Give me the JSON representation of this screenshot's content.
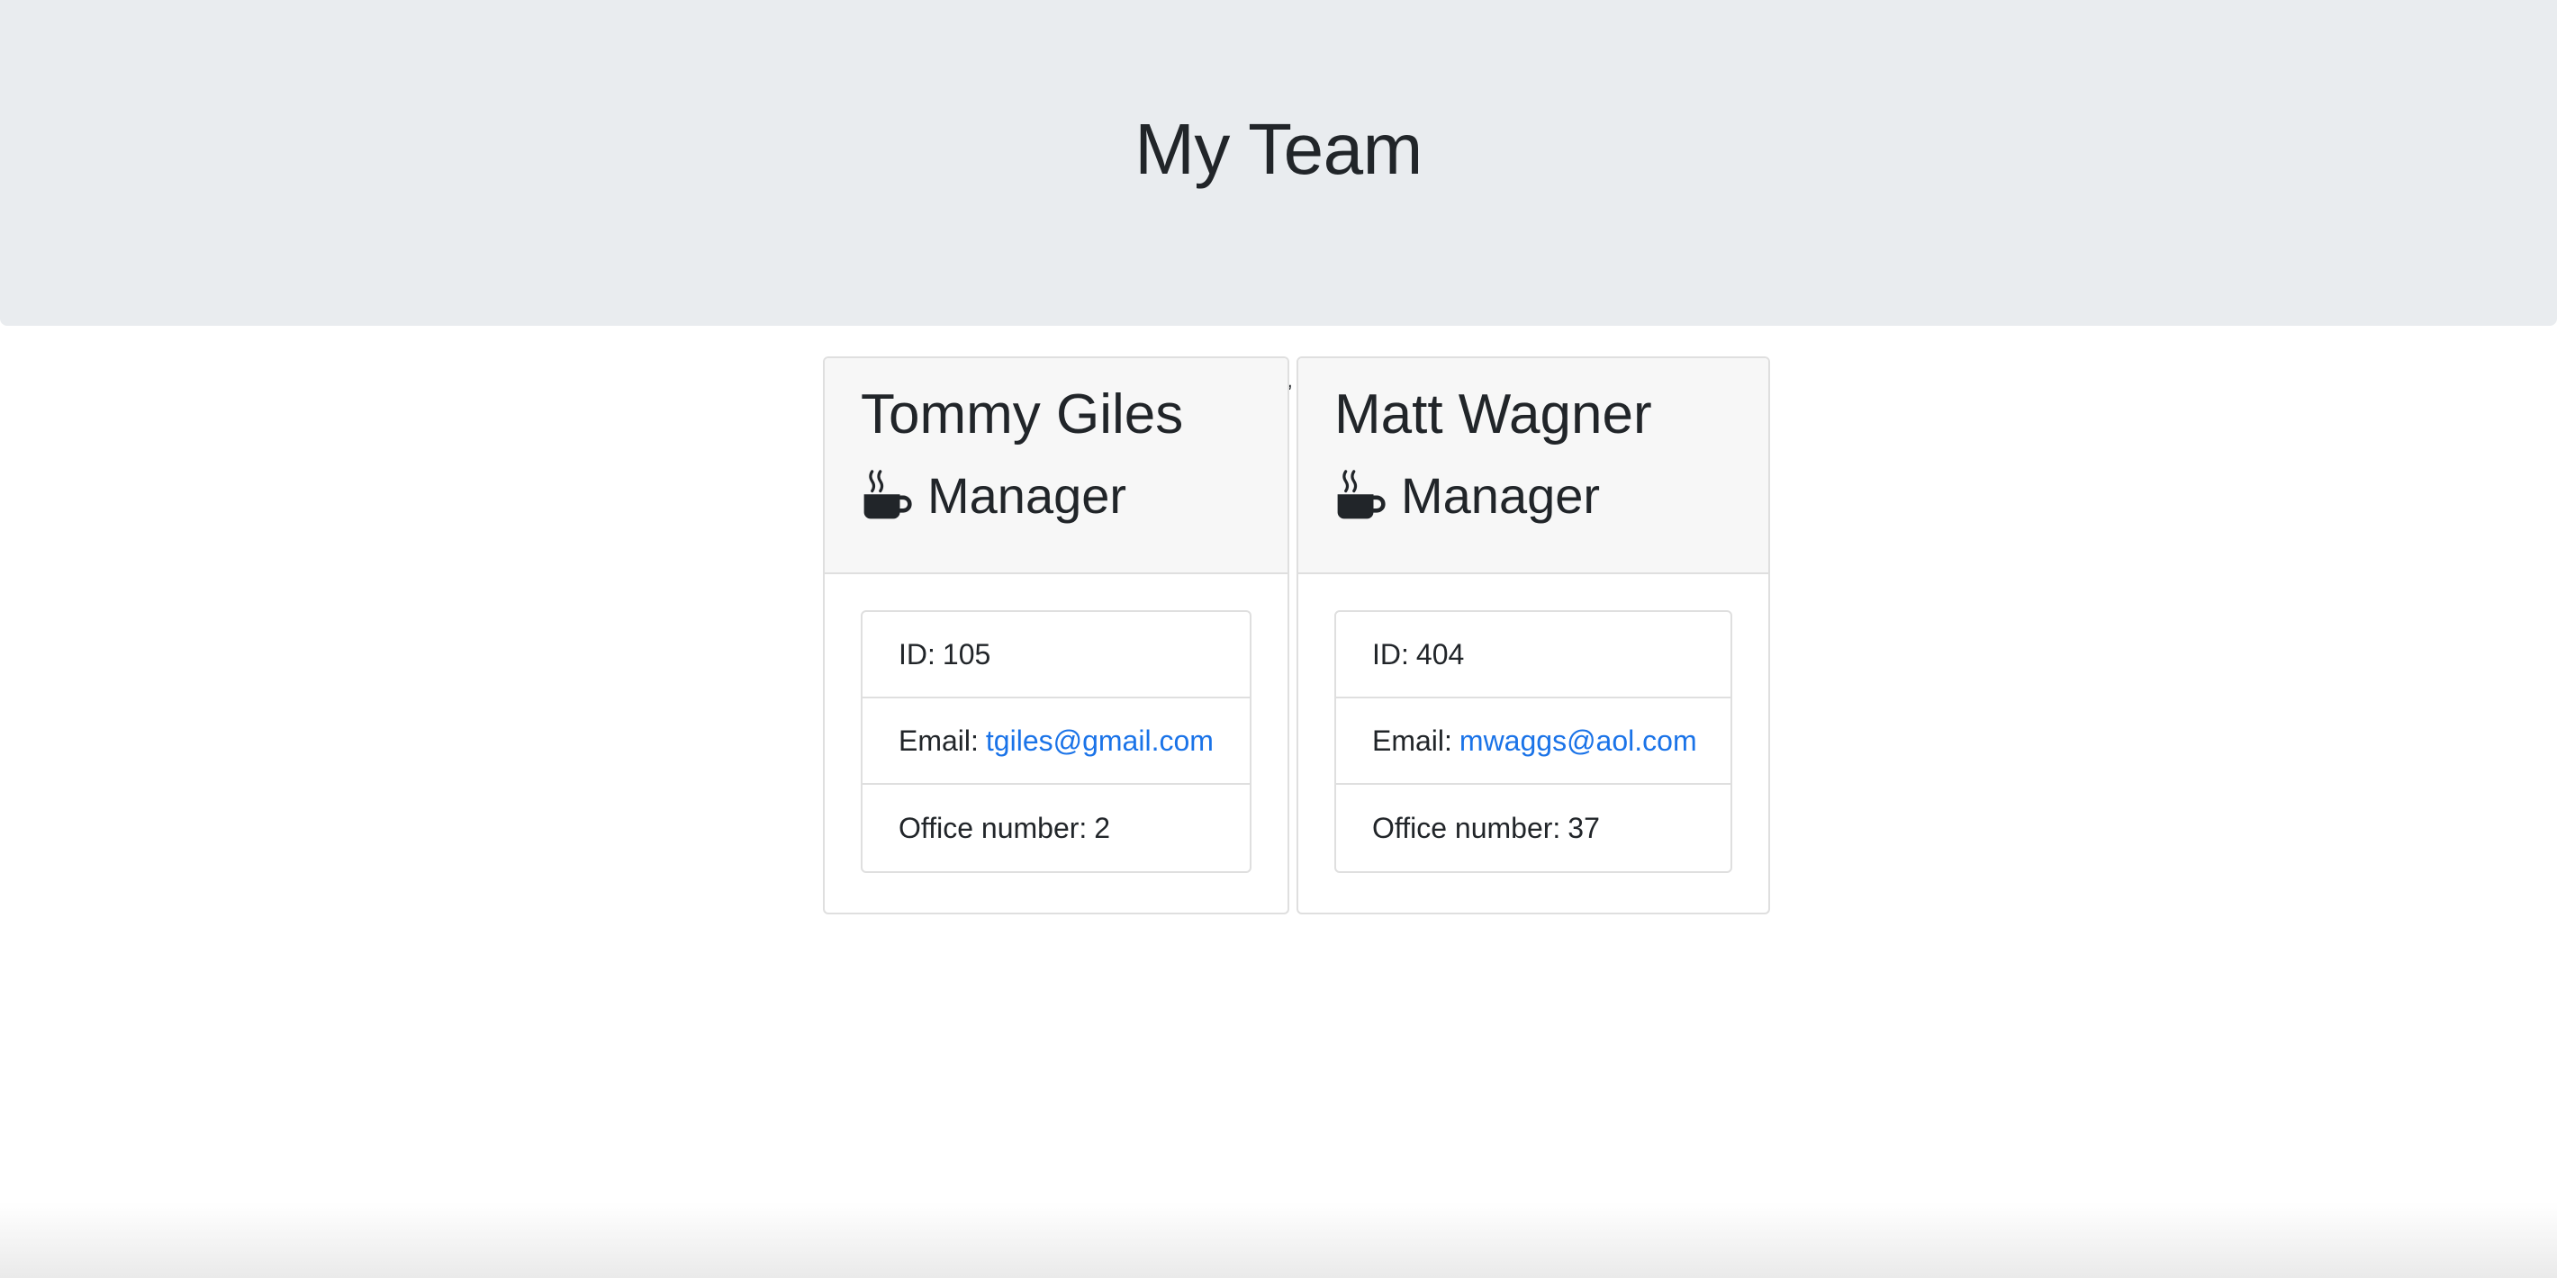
{
  "header": {
    "title": "My Team"
  },
  "employees": [
    {
      "name": "Tommy Giles",
      "role": "Manager",
      "role_icon": "coffee-mug-icon",
      "id_label": "ID:",
      "id": "105",
      "email_label": "Email:",
      "email": "tgiles@gmail.com",
      "office_label": "Office number:",
      "office": "2"
    },
    {
      "name": "Matt Wagner",
      "role": "Manager",
      "role_icon": "coffee-mug-icon",
      "id_label": "ID:",
      "id": "404",
      "email_label": "Email:",
      "email": "mwaggs@aol.com",
      "office_label": "Office number:",
      "office": "37"
    }
  ],
  "colors": {
    "header_bg": "#e9ecef",
    "card_header_bg": "#f7f7f7",
    "link": "#1a73e8",
    "text": "#212529"
  }
}
